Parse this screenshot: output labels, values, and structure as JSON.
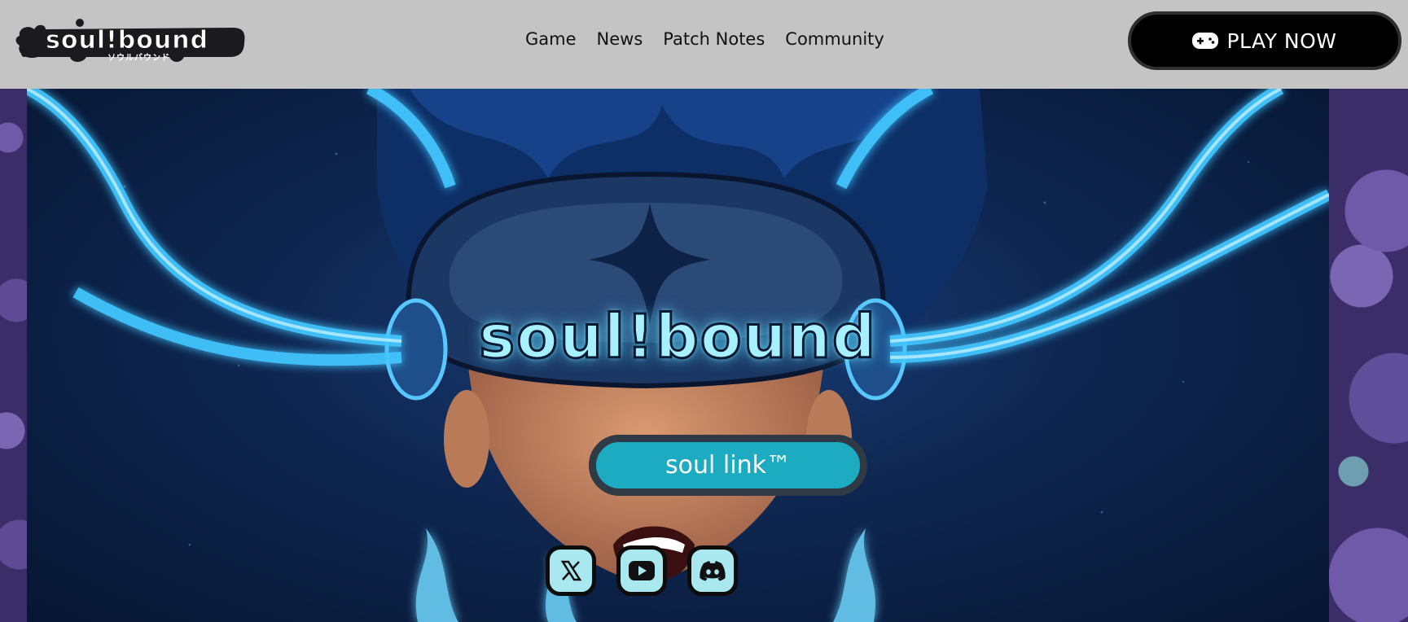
{
  "header": {
    "logo": {
      "text": "soul!bound",
      "subtext": "ソウルバウンド"
    },
    "nav": [
      {
        "label": "Game"
      },
      {
        "label": "News"
      },
      {
        "label": "Patch Notes"
      },
      {
        "label": "Community"
      }
    ],
    "play_button": {
      "label": "PLAY NOW",
      "icon": "gamepad-icon"
    }
  },
  "hero": {
    "title": "soul!bound",
    "cta_label": "soul link™",
    "socials": [
      {
        "icon": "x-twitter-icon"
      },
      {
        "icon": "youtube-icon"
      },
      {
        "icon": "discord-icon"
      }
    ]
  },
  "colors": {
    "header_bg": "#c4c4c4",
    "accent_cyan": "#1cabc0",
    "title_glow": "#a6f0ff",
    "social_bg": "#a9e8ef",
    "hero_bg": "#0e2650",
    "side_purple": "#3a2d68"
  }
}
